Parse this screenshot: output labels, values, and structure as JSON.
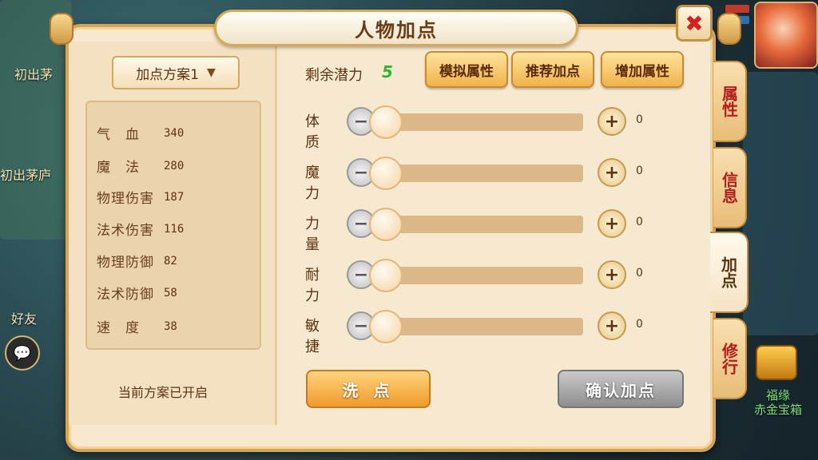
{
  "background": {
    "labels": [
      "初出茅",
      "初出茅庐",
      "好友"
    ],
    "treasure_label_1": "福缘",
    "treasure_label_2": "赤金宝箱"
  },
  "window": {
    "title": "人物加点",
    "close_symbol": "✖"
  },
  "scheme": {
    "selected": "加点方案1",
    "status": "当前方案已开启"
  },
  "stats": [
    {
      "name": "气　血",
      "value": "340"
    },
    {
      "name": "魔　法",
      "value": "280"
    },
    {
      "name": "物理伤害",
      "value": "187"
    },
    {
      "name": "法术伤害",
      "value": "116"
    },
    {
      "name": "物理防御",
      "value": "82"
    },
    {
      "name": "法术防御",
      "value": "58"
    },
    {
      "name": "速　度",
      "value": "38"
    }
  ],
  "potential": {
    "label": "剩余潜力",
    "value": "5"
  },
  "top_buttons": {
    "simulate": "模拟属性",
    "recommend": "推荐加点",
    "add": "增加属性"
  },
  "attributes": [
    {
      "name": "体质",
      "value": "0"
    },
    {
      "name": "魔力",
      "value": "0"
    },
    {
      "name": "力量",
      "value": "0"
    },
    {
      "name": "耐力",
      "value": "0"
    },
    {
      "name": "敏捷",
      "value": "0"
    }
  ],
  "controls": {
    "minus_symbol": "−",
    "plus_symbol": "+"
  },
  "bottom_buttons": {
    "wash": "洗 点",
    "confirm": "确认加点"
  },
  "side_tabs": [
    {
      "label": "属性",
      "active": false
    },
    {
      "label": "信息",
      "active": false
    },
    {
      "label": "加点",
      "active": true
    },
    {
      "label": "修行",
      "active": false
    }
  ],
  "colors": {
    "panel_bg": "#f7e9cf",
    "accent_border": "#d6a459",
    "potential_green": "#32b52a",
    "tab_red": "#b51d1d"
  },
  "icons": {
    "close": "close-icon",
    "chevron": "chevron-down-icon",
    "chat": "chat-icon",
    "treasure": "treasure-chest-icon"
  }
}
